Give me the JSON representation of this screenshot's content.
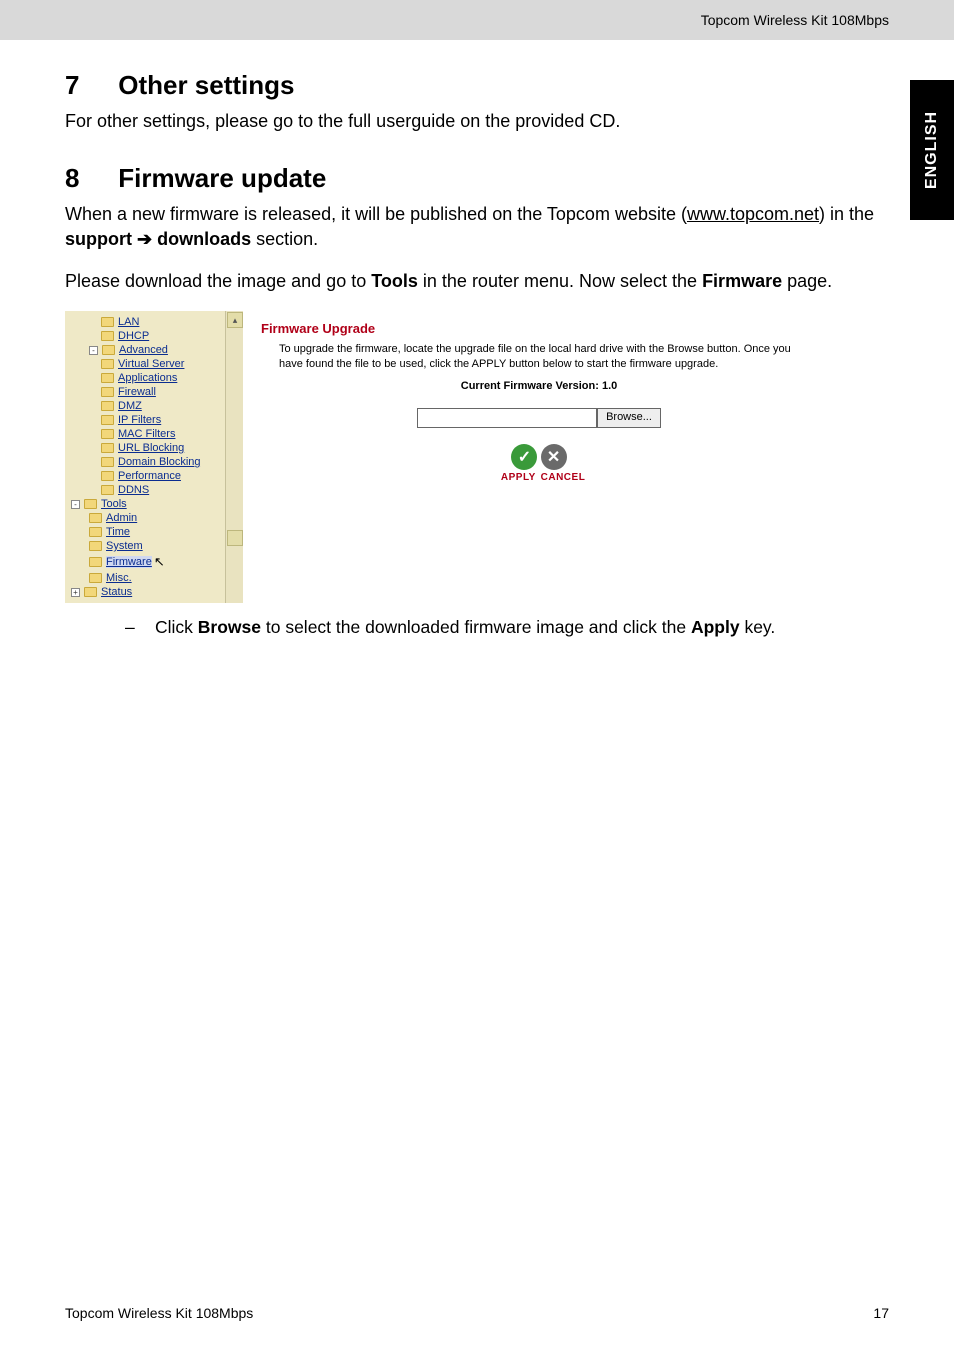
{
  "header": {
    "product": "Topcom Wireless Kit 108Mbps"
  },
  "sideTab": "ENGLISH",
  "section7": {
    "num": "7",
    "title": "Other settings",
    "text": "For other settings, please go to the full userguide on the provided CD."
  },
  "section8": {
    "num": "8",
    "title": "Firmware update",
    "line1a": "When a new firmware is released, it will be published on the Topcom website (",
    "link": "www.topcom.net",
    "line1b": ") in the ",
    "supportWord": "support",
    "arrow": "➔",
    "downloadsWord": "downloads",
    "line1c": " section.",
    "line2a": "Please download the image and go to ",
    "toolsWord": "Tools",
    "line2b": " in the router menu. Now select the ",
    "firmwareWord": "Firmware",
    "line2c": " page."
  },
  "routerTree": {
    "lan": "LAN",
    "dhcp": "DHCP",
    "advanced": "Advanced",
    "virtualServer": "Virtual Server",
    "applications": "Applications",
    "firewall": "Firewall",
    "dmz": "DMZ",
    "ipFilters": "IP Filters",
    "macFilters": "MAC Filters",
    "urlBlocking": "URL Blocking",
    "domainBlocking": "Domain Blocking",
    "performance": "Performance",
    "ddns": "DDNS",
    "tools": "Tools",
    "admin": "Admin",
    "time": "Time",
    "system": "System",
    "firmware": "Firmware",
    "misc": "Misc.",
    "status": "Status"
  },
  "firmwarePane": {
    "title": "Firmware Upgrade",
    "desc": "To upgrade the firmware, locate the upgrade file on the local hard drive with the Browse button. Once you have found the file to be used, click the APPLY button below to start the firmware upgrade.",
    "versionLabel": "Current Firmware Version: 1.0",
    "browse": "Browse...",
    "applyLabel": "APPLY",
    "cancelLabel": "CANCEL"
  },
  "bullet": {
    "a": "Click ",
    "browse": "Browse",
    "b": " to select the downloaded firmware image and click the ",
    "apply": "Apply",
    "c": " key."
  },
  "footer": {
    "left": "Topcom Wireless Kit 108Mbps",
    "right": "17"
  }
}
